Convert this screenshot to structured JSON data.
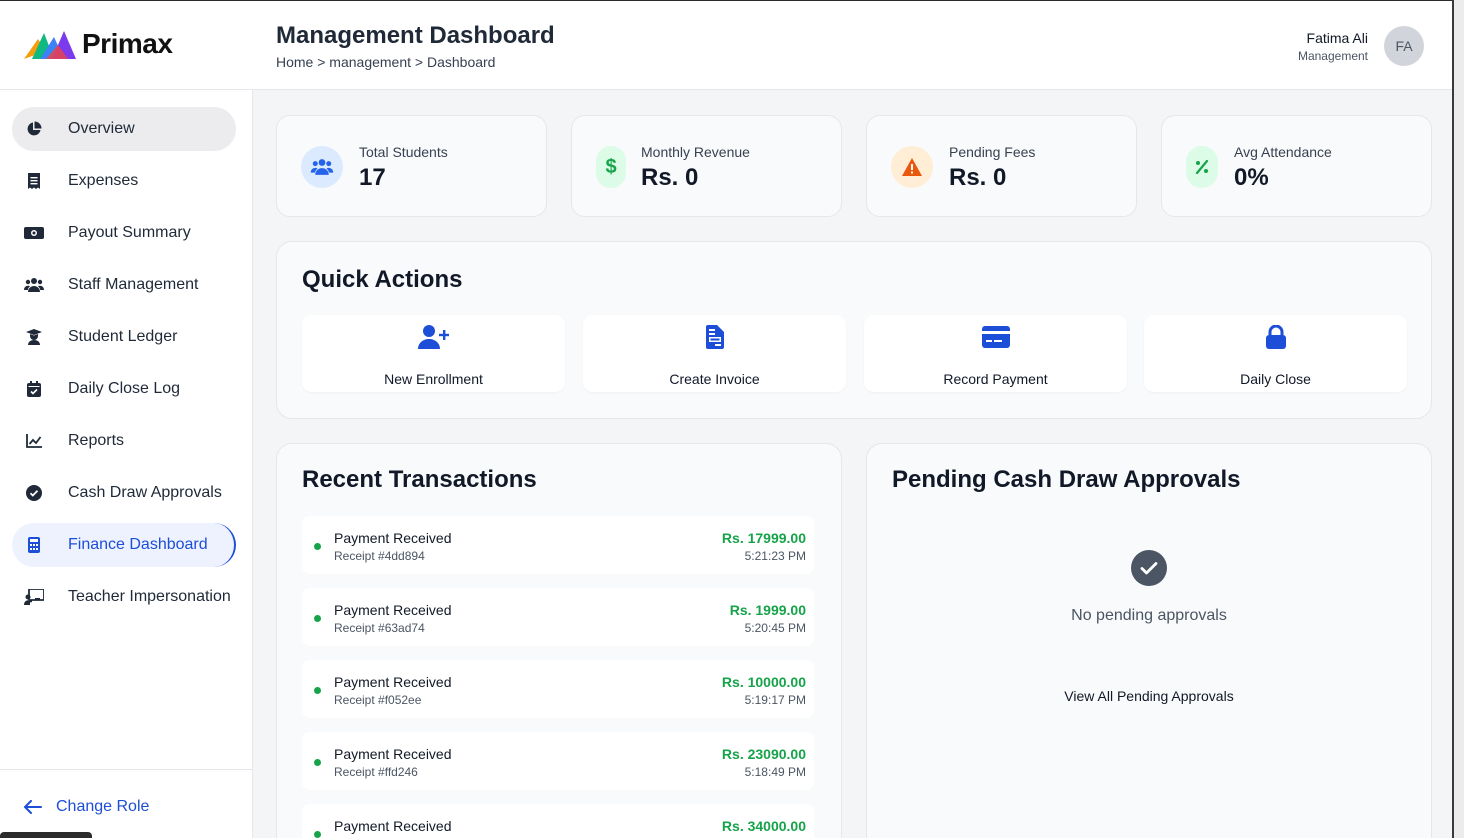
{
  "app": {
    "brand": "Primax"
  },
  "header": {
    "title": "Management Dashboard",
    "breadcrumb": "Home > management > Dashboard",
    "user_name": "Fatima Ali",
    "user_role": "Management",
    "avatar_initials": "FA"
  },
  "sidebar": {
    "items": [
      {
        "label": "Overview",
        "icon": "pie-chart-icon"
      },
      {
        "label": "Expenses",
        "icon": "receipt-icon"
      },
      {
        "label": "Payout Summary",
        "icon": "money-bill-icon"
      },
      {
        "label": "Staff Management",
        "icon": "users-icon"
      },
      {
        "label": "Student Ledger",
        "icon": "graduate-icon"
      },
      {
        "label": "Daily Close Log",
        "icon": "calendar-check-icon"
      },
      {
        "label": "Reports",
        "icon": "line-chart-icon"
      },
      {
        "label": "Cash Draw Approvals",
        "icon": "check-circle-icon"
      },
      {
        "label": "Finance Dashboard",
        "icon": "calculator-icon"
      },
      {
        "label": "Teacher Impersonation",
        "icon": "chalkboard-teacher-icon"
      }
    ],
    "active": "Overview",
    "footer_label": "Change Role"
  },
  "stats": [
    {
      "label": "Total Students",
      "value": "17",
      "icon": "users-icon",
      "color": "#2563eb",
      "bg": "#dbeafe"
    },
    {
      "label": "Monthly Revenue",
      "value": "Rs. 0",
      "icon": "dollar-icon",
      "color": "#16a34a",
      "bg": "#dcfce7"
    },
    {
      "label": "Pending Fees",
      "value": "Rs. 0",
      "icon": "warning-icon",
      "color": "#ea580c",
      "bg": "#ffedd5"
    },
    {
      "label": "Avg Attendance",
      "value": "0%",
      "icon": "percent-icon",
      "color": "#16a34a",
      "bg": "#dcfce7"
    }
  ],
  "quick_actions": {
    "title": "Quick Actions",
    "items": [
      {
        "label": "New Enrollment",
        "icon": "user-plus-icon"
      },
      {
        "label": "Create Invoice",
        "icon": "invoice-icon"
      },
      {
        "label": "Record Payment",
        "icon": "credit-card-icon"
      },
      {
        "label": "Daily Close",
        "icon": "lock-icon"
      }
    ]
  },
  "recent_transactions": {
    "title": "Recent Transactions",
    "items": [
      {
        "title": "Payment Received",
        "receipt": "Receipt #4dd894",
        "amount": "Rs. 17999.00",
        "time": "5:21:23 PM"
      },
      {
        "title": "Payment Received",
        "receipt": "Receipt #63ad74",
        "amount": "Rs. 1999.00",
        "time": "5:20:45 PM"
      },
      {
        "title": "Payment Received",
        "receipt": "Receipt #f052ee",
        "amount": "Rs. 10000.00",
        "time": "5:19:17 PM"
      },
      {
        "title": "Payment Received",
        "receipt": "Receipt #ffd246",
        "amount": "Rs. 23090.00",
        "time": "5:18:49 PM"
      },
      {
        "title": "Payment Received",
        "receipt": "",
        "amount": "Rs. 34000.00",
        "time": ""
      }
    ]
  },
  "pending_approvals": {
    "title": "Pending Cash Draw Approvals",
    "empty_text": "No pending approvals",
    "view_all_label": "View All Pending Approvals"
  }
}
